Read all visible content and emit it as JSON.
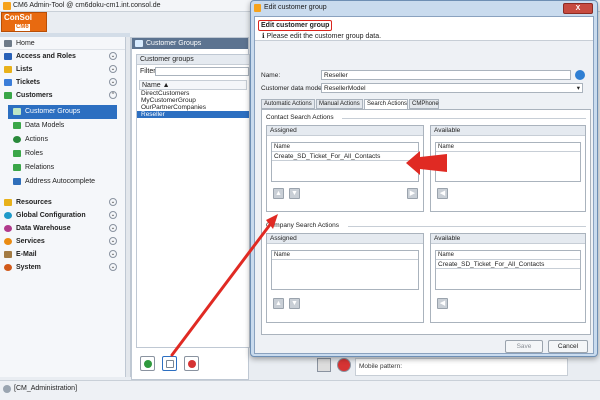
{
  "app": {
    "title": "CM6 Admin-Tool @ cm6doku-cm1.int.consol.de",
    "logo_top": "ConSol",
    "logo_bottom": "CM6"
  },
  "sidebar": {
    "home": "Home",
    "sections": [
      {
        "label": "Access and Roles",
        "color": "#2a62b8"
      },
      {
        "label": "Lists",
        "color": "#e8b11a"
      },
      {
        "label": "Tickets",
        "color": "#3b7dd8"
      },
      {
        "label": "Customers",
        "color": "#3aa648"
      }
    ],
    "customer_items": [
      {
        "label": "Customer Groups",
        "color": "#3aa648"
      },
      {
        "label": "Data Models",
        "color": "#3aa648"
      },
      {
        "label": "Actions",
        "color": "#2a8a3b"
      },
      {
        "label": "Roles",
        "color": "#3aa648"
      },
      {
        "label": "Relations",
        "color": "#3aa648"
      },
      {
        "label": "Address Autocomplete",
        "color": "#2f6fba"
      }
    ],
    "lower_sections": [
      {
        "label": "Resources",
        "color": "#e8b11a"
      },
      {
        "label": "Global Configuration",
        "color": "#1f9ac9"
      },
      {
        "label": "Data Warehouse",
        "color": "#b03a8c"
      },
      {
        "label": "Services",
        "color": "#ea8b12"
      },
      {
        "label": "E-Mail",
        "color": "#a37b44"
      },
      {
        "label": "System",
        "color": "#d15a1b"
      }
    ]
  },
  "customer_groups": {
    "header": "Customer Groups",
    "box_title": "Customer groups",
    "filter_label": "Filter:",
    "column": "Name",
    "rows": [
      "DirectCustomers",
      "MyCustomerGroup",
      "OurPartnerCompanies",
      "Reseller"
    ],
    "selected_index": 3
  },
  "background": {
    "mobile_pattern": "Mobile pattern:"
  },
  "statusbar": {
    "user": "[CM_Administration]"
  },
  "dialog": {
    "title": "Edit customer group",
    "close": "X",
    "header": "Edit customer group",
    "info": "Please edit the customer group data.",
    "name_label": "Name:",
    "name_value": "Reseller",
    "model_label": "Customer data model:",
    "model_value": "ResellerModel",
    "tabs": [
      "Automatic Actions",
      "Manual Actions",
      "Search Actions",
      "CMPhone"
    ],
    "active_tab": 2,
    "contact": {
      "section": "Contact Search Actions",
      "assigned": "Assigned",
      "available": "Available",
      "name_col": "Name",
      "assigned_items": [
        "Create_SD_Ticket_For_All_Contacts"
      ],
      "available_items": []
    },
    "company": {
      "section": "Company Search Actions",
      "assigned": "Assigned",
      "available": "Available",
      "name_col": "Name",
      "assigned_items": [],
      "available_items": [
        "Create_SD_Ticket_For_All_Contacts"
      ]
    },
    "save": "Save",
    "cancel": "Cancel"
  },
  "colors": {
    "accent_red": "#e02a23",
    "selection_blue": "#2c6fc1",
    "dialog_frame": "#c9dbee"
  }
}
